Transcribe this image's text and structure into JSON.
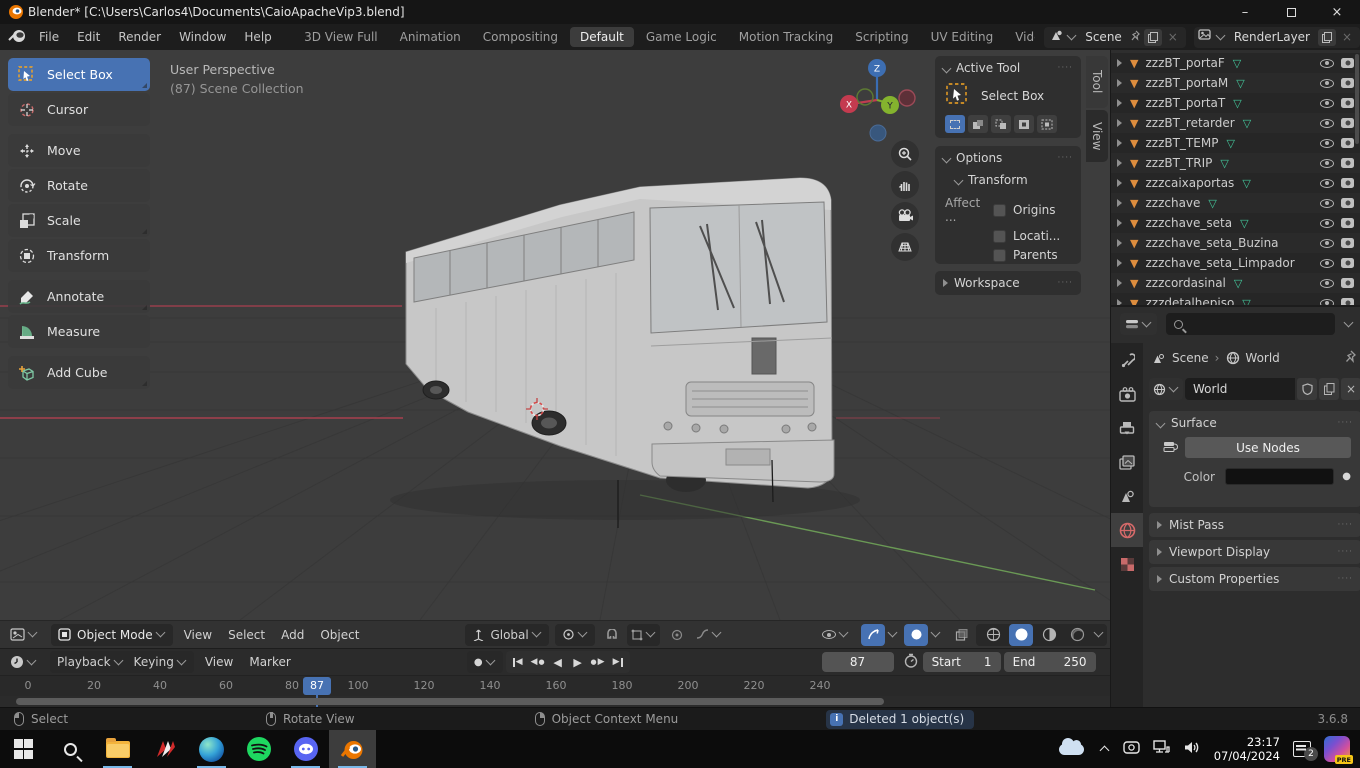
{
  "title_bar": {
    "title": "Blender* [C:\\Users\\Carlos4\\Documents\\CaioApacheVip3.blend]"
  },
  "menu_bar": {
    "menus": [
      "File",
      "Edit",
      "Render",
      "Window",
      "Help"
    ],
    "workspaces": [
      "3D View Full",
      "Animation",
      "Compositing",
      "Default",
      "Game Logic",
      "Motion Tracking",
      "Scripting",
      "UV Editing",
      "Vide"
    ],
    "scene_label": "Scene",
    "render_layer_label": "RenderLayer"
  },
  "toolbar": {
    "tools": [
      "Select Box",
      "Cursor",
      "Move",
      "Rotate",
      "Scale",
      "Transform",
      "Annotate",
      "Measure",
      "Add Cube"
    ]
  },
  "viewport": {
    "view_label": "User Perspective",
    "collection_label": "(87) Scene Collection",
    "axis": {
      "x": "X",
      "y": "Y",
      "z": "Z"
    }
  },
  "tool_panel": {
    "active_tool_header": "Active Tool",
    "tool_name": "Select Box",
    "options_header": "Options",
    "transform_header": "Transform",
    "affect_label": "Affect ...",
    "origins_label": "Origins",
    "locations_label": "Locati...",
    "parents_label": "Parents",
    "workspace_header": "Workspace",
    "side_tabs": [
      "Tool",
      "View"
    ]
  },
  "outliner": {
    "items": [
      {
        "name": "zzzBT_portaF"
      },
      {
        "name": "zzzBT_portaM"
      },
      {
        "name": "zzzBT_portaT"
      },
      {
        "name": "zzzBT_retarder"
      },
      {
        "name": "zzzBT_TEMP"
      },
      {
        "name": "zzzBT_TRIP"
      },
      {
        "name": "zzzcaixaportas"
      },
      {
        "name": "zzzchave"
      },
      {
        "name": "zzzchave_seta"
      },
      {
        "name": "zzzchave_seta_Buzina"
      },
      {
        "name": "zzzchave_seta_Limpador"
      },
      {
        "name": "zzzcordasinal"
      },
      {
        "name": "zzzdetalhepiso"
      }
    ]
  },
  "properties": {
    "breadcrumb_scene": "Scene",
    "breadcrumb_target": "World",
    "datablock_name": "World",
    "surface_header": "Surface",
    "use_nodes_label": "Use Nodes",
    "color_label": "Color",
    "mist_pass_header": "Mist Pass",
    "viewport_display_header": "Viewport Display",
    "custom_properties_header": "Custom Properties"
  },
  "viewport_header": {
    "mode_label": "Object Mode",
    "menus": [
      "View",
      "Select",
      "Add",
      "Object"
    ],
    "orientation_label": "Global"
  },
  "timeline": {
    "menus": [
      "Playback",
      "Keying",
      "View",
      "Marker"
    ],
    "current_frame": "87",
    "playhead": "87",
    "start_label": "Start",
    "start_value": "1",
    "end_label": "End",
    "end_value": "250",
    "ticks": [
      "0",
      "20",
      "40",
      "60",
      "80",
      "100",
      "120",
      "140",
      "160",
      "180",
      "200",
      "220",
      "240"
    ]
  },
  "status_bar": {
    "select_hint": "Select",
    "rotate_hint": "Rotate View",
    "context_hint": "Object Context Menu",
    "message": "Deleted 1 object(s)",
    "version": "3.6.8"
  },
  "taskbar": {
    "time": "23:17",
    "date": "07/04/2024",
    "notification_count": "2",
    "paint_badge": "PRE"
  }
}
